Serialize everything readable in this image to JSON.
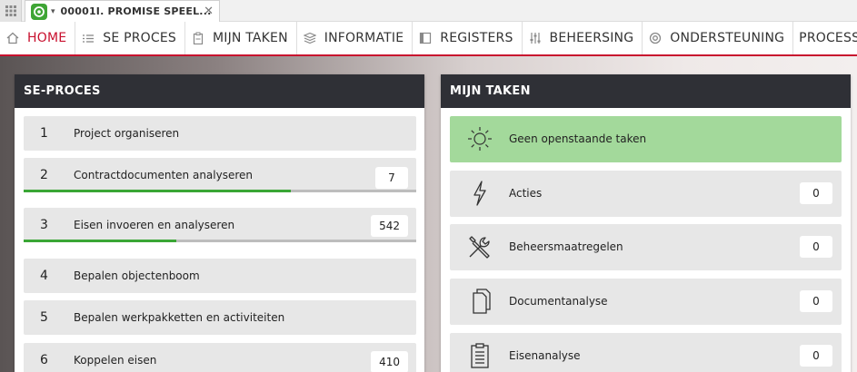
{
  "app": {
    "tab_title": "00001I. PROMISE SPEEL...",
    "tab_close": "✕",
    "tab_chevron": "▾"
  },
  "nav": [
    {
      "label": "HOME",
      "icon": "home-icon",
      "active": true
    },
    {
      "label": "SE PROCES",
      "icon": "list-icon"
    },
    {
      "label": "MIJN TAKEN",
      "icon": "clipboard-icon"
    },
    {
      "label": "INFORMATIE",
      "icon": "layers-icon"
    },
    {
      "label": "REGISTERS",
      "icon": "register-icon"
    },
    {
      "label": "BEHEERSING",
      "icon": "sliders-icon"
    },
    {
      "label": "ONDERSTEUNING",
      "icon": "lifebuoy-icon"
    },
    {
      "label": "PROCESSEN",
      "icon": ""
    }
  ],
  "se_panel": {
    "title": "SE-PROCES",
    "rows": [
      {
        "num": "1",
        "label": "Project organiseren",
        "badge": null,
        "progress": null
      },
      {
        "num": "2",
        "label": "Contractdocumenten analyseren",
        "badge": "7",
        "progress": 0.68
      },
      {
        "num": "3",
        "label": "Eisen invoeren en analyseren",
        "badge": "542",
        "progress": 0.39
      },
      {
        "num": "4",
        "label": "Bepalen objectenboom",
        "badge": null,
        "progress": null
      },
      {
        "num": "5",
        "label": "Bepalen werkpakketten en activiteiten",
        "badge": null,
        "progress": null
      },
      {
        "num": "6",
        "label": "Koppelen eisen",
        "badge": "410",
        "progress": null
      }
    ]
  },
  "tasks_panel": {
    "title": "MIJN TAKEN",
    "rows": [
      {
        "label": "Geen openstaande taken",
        "icon": "sun-icon",
        "badge": null,
        "status": "ok"
      },
      {
        "label": "Acties",
        "icon": "lightning-icon",
        "badge": "0"
      },
      {
        "label": "Beheersmaatregelen",
        "icon": "tools-icon",
        "badge": "0"
      },
      {
        "label": "Documentanalyse",
        "icon": "documents-icon",
        "badge": "0"
      },
      {
        "label": "Eisenanalyse",
        "icon": "clipboard-list-icon",
        "badge": "0"
      }
    ]
  },
  "colors": {
    "accent": "#c8102e",
    "header": "#2f3036",
    "progress": "#3aa635",
    "ok_row": "#a3d99b",
    "logo": "#3fa535"
  }
}
